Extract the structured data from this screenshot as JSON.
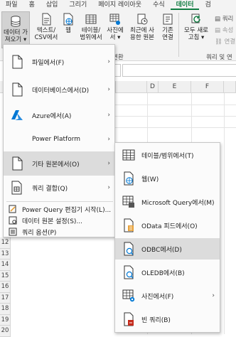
{
  "tabs": [
    "파일",
    "홈",
    "삽입",
    "그리기",
    "페이지 레이아웃",
    "수식",
    "데이터",
    "검"
  ],
  "ribbon": {
    "get_data": "데이터 가\n져오기 ▾",
    "text_csv": "텍스트/\nCSV에서",
    "web": "웹",
    "table_range": "테이블/\n범위에서",
    "from_picture": "사진에\n서 ▾",
    "recent_sources": "최근에 사\n용한 원본",
    "existing_connections": "기존\n연결",
    "refresh_all": "모두 새로\n고침 ▾",
    "queries_label": "쿼리",
    "properties_label": "속성",
    "edit_links_label": "연결",
    "group_transform_label": "변환",
    "group_queries_label": "쿼리 및 연"
  },
  "columns": [
    "D",
    "E",
    "F"
  ],
  "rows": [
    "12",
    "13",
    "14",
    "15",
    "16",
    "17",
    "18",
    "19",
    "20",
    "21",
    "22",
    "23",
    "24",
    "25"
  ],
  "menu": {
    "items": [
      {
        "label": "파일에서(F)",
        "arrow": "›"
      },
      {
        "label": "데이터베이스에서(D)",
        "arrow": "›"
      },
      {
        "label": "Azure에서(A)",
        "arrow": "›"
      },
      {
        "label": "Power Platform",
        "arrow": "›"
      },
      {
        "label": "기타 원본에서(O)",
        "arrow": "›"
      },
      {
        "label": "쿼리 결합(Q)",
        "arrow": "›"
      }
    ],
    "small_items": [
      {
        "label": "Power Query 편집기 시작(L)..."
      },
      {
        "label": "데이터 원본 설정(S)..."
      },
      {
        "label": "쿼리 옵션(P)"
      }
    ]
  },
  "submenu": {
    "items": [
      {
        "label": "테이블/범위에서(T)"
      },
      {
        "label": "웹(W)"
      },
      {
        "label": "Microsoft Query에서(M)"
      },
      {
        "label": "OData 피드에서(O)"
      },
      {
        "label": "ODBC에서(D)"
      },
      {
        "label": "OLEDB에서(B)"
      },
      {
        "label": "사진에서(F)",
        "arrow": "›"
      },
      {
        "label": "빈 쿼리(B)"
      }
    ]
  },
  "colors": {
    "accent": "#107c41",
    "highlight": "#dcdcdc",
    "azure_blue": "#0078d4",
    "odata_orange": "#e8a33d",
    "blank_query_red": "#c42b1c"
  }
}
